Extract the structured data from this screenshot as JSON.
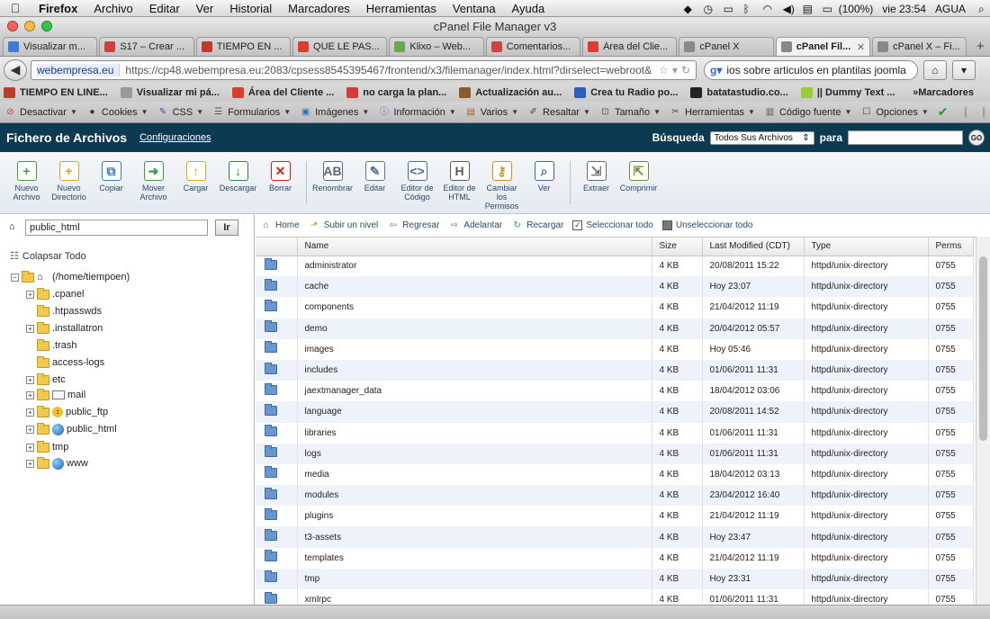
{
  "menubar": {
    "app": "Firefox",
    "items": [
      "Archivo",
      "Editar",
      "Ver",
      "Historial",
      "Marcadores",
      "Herramientas",
      "Ventana",
      "Ayuda"
    ],
    "battery": "(100%)",
    "clock": "vie 23:54",
    "user": "AGUA"
  },
  "window": {
    "title": "cPanel File Manager v3"
  },
  "tabs": [
    {
      "label": "Visualizar m...",
      "color": "#3a7bd5"
    },
    {
      "label": "S17 – Crear ...",
      "color": "#d04040"
    },
    {
      "label": "TIEMPO EN ...",
      "color": "#c0392b"
    },
    {
      "label": "QUE LE PAS...",
      "color": "#e03b2c"
    },
    {
      "label": "Klixo – Web...",
      "color": "#6aa84f"
    },
    {
      "label": "Comentarios...",
      "color": "#cc4444"
    },
    {
      "label": "Área del Clie...",
      "color": "#e03b2c"
    },
    {
      "label": "cPanel X",
      "color": "#888888"
    },
    {
      "label": "cPanel Fil...",
      "color": "#888888",
      "active": true
    },
    {
      "label": "cPanel X – Fi...",
      "color": "#888888"
    }
  ],
  "navbar": {
    "site": "webempresa.eu",
    "url": "https://cp48.webempresa.eu:2083/cpsess8545395467/frontend/x3/filemanager/index.html?dirselect=webroot&",
    "search": "ios sobre articulos en plantilas joomla"
  },
  "bookmarks": [
    {
      "label": "TIEMPO EN LINE...",
      "color": "#c0392b"
    },
    {
      "label": "Visualizar mi pá...",
      "color": "#999999"
    },
    {
      "label": "Área del Cliente ...",
      "color": "#e03b2c"
    },
    {
      "label": "no carga la plan...",
      "color": "#d43b3b"
    },
    {
      "label": "Actualización au...",
      "color": "#8b5a2b"
    },
    {
      "label": "Crea tu Radio po...",
      "color": "#2b5fbf"
    },
    {
      "label": "batatastudio.co...",
      "color": "#222222"
    },
    {
      "label": "|| Dummy Text ...",
      "color": "#9acd32"
    }
  ],
  "bookmarks_more": "Marcadores",
  "devbar": [
    "Desactivar",
    "Cookies",
    "CSS",
    "Formularios",
    "Imágenes",
    "Información",
    "Varios",
    "Resaltar",
    "Tamaño",
    "Herramientas",
    "Código fuente",
    "Opciones"
  ],
  "cpanel": {
    "title": "Fichero de Archivos",
    "config": "Configuraciones",
    "search_label": "Búsqueda",
    "search_scope": "Todos Sus Archivos",
    "search_para": "para",
    "go": "GO"
  },
  "toolbar": [
    {
      "label": "Nuevo Archivo",
      "color": "#4a9a3a",
      "glyph": "+"
    },
    {
      "label": "Nuevo Directorio",
      "color": "#e0a020",
      "glyph": "+"
    },
    {
      "label": "Copiar",
      "color": "#3a7ac0",
      "glyph": "⧉"
    },
    {
      "label": "Mover Archivo",
      "color": "#3a9a4a",
      "glyph": "➜"
    },
    {
      "label": "Cargar",
      "color": "#e0a020",
      "glyph": "↑"
    },
    {
      "label": "Descargar",
      "color": "#2a8a3a",
      "glyph": "↓"
    },
    {
      "label": "Borrar",
      "color": "#d02020",
      "glyph": "✕"
    },
    {
      "label": "Renombrar",
      "color": "#5a6a7a",
      "glyph": "AB"
    },
    {
      "label": "Editar",
      "color": "#5a7a9a",
      "glyph": "✎"
    },
    {
      "label": "Editor de Código",
      "color": "#4a6a9a",
      "glyph": "&lt;&gt;"
    },
    {
      "label": "Editor de HTML",
      "color": "#5a5a5a",
      "glyph": "H"
    },
    {
      "label": "Cambiar los Permisos",
      "color": "#d09020",
      "glyph": "⚷"
    },
    {
      "label": "Ver",
      "color": "#3a6aa0",
      "glyph": "⌕"
    },
    {
      "label": "Extraer",
      "color": "#6a6a6a",
      "glyph": "⇲"
    },
    {
      "label": "Comprimir",
      "color": "#6a8a3a",
      "glyph": "⇱"
    }
  ],
  "left": {
    "path": "public_html",
    "go": "Ir",
    "collapse": "Colapsar Todo",
    "root": "(/home/tiempoen)",
    "tree": [
      {
        "label": ".cpanel",
        "exp": true,
        "icon": "folder"
      },
      {
        "label": ".htpasswds",
        "exp": false,
        "icon": "folder"
      },
      {
        "label": ".installatron",
        "exp": true,
        "icon": "folder"
      },
      {
        "label": ".trash",
        "exp": false,
        "icon": "folder"
      },
      {
        "label": "access-logs",
        "exp": false,
        "icon": "folder"
      },
      {
        "label": "etc",
        "exp": true,
        "icon": "folder"
      },
      {
        "label": "mail",
        "exp": true,
        "icon": "mail"
      },
      {
        "label": "public_ftp",
        "exp": true,
        "icon": "ftp"
      },
      {
        "label": "public_html",
        "exp": true,
        "icon": "globe"
      },
      {
        "label": "tmp",
        "exp": true,
        "icon": "folder"
      },
      {
        "label": "www",
        "exp": true,
        "icon": "globe"
      }
    ]
  },
  "navrow": {
    "home": "Home",
    "up": "Subir un nivel",
    "back": "Regresar",
    "forward": "Adelantar",
    "reload": "Recargar",
    "selectall": "Seleccionar todo",
    "unselectall": "Unseleccionar todo"
  },
  "table": {
    "headers": [
      "Name",
      "Size",
      "Last Modified (CDT)",
      "Type",
      "Perms"
    ],
    "rows": [
      [
        "administrator",
        "4 KB",
        "20/08/2011 15:22",
        "httpd/unix-directory",
        "0755"
      ],
      [
        "cache",
        "4 KB",
        "Hoy 23:07",
        "httpd/unix-directory",
        "0755"
      ],
      [
        "components",
        "4 KB",
        "21/04/2012 11:19",
        "httpd/unix-directory",
        "0755"
      ],
      [
        "demo",
        "4 KB",
        "20/04/2012 05:57",
        "httpd/unix-directory",
        "0755"
      ],
      [
        "images",
        "4 KB",
        "Hoy 05:46",
        "httpd/unix-directory",
        "0755"
      ],
      [
        "includes",
        "4 KB",
        "01/06/2011 11:31",
        "httpd/unix-directory",
        "0755"
      ],
      [
        "jaextmanager_data",
        "4 KB",
        "18/04/2012 03:06",
        "httpd/unix-directory",
        "0755"
      ],
      [
        "language",
        "4 KB",
        "20/08/2011 14:52",
        "httpd/unix-directory",
        "0755"
      ],
      [
        "libraries",
        "4 KB",
        "01/06/2011 11:31",
        "httpd/unix-directory",
        "0755"
      ],
      [
        "logs",
        "4 KB",
        "01/06/2011 11:31",
        "httpd/unix-directory",
        "0755"
      ],
      [
        "media",
        "4 KB",
        "18/04/2012 03:13",
        "httpd/unix-directory",
        "0755"
      ],
      [
        "modules",
        "4 KB",
        "23/04/2012 16:40",
        "httpd/unix-directory",
        "0755"
      ],
      [
        "plugins",
        "4 KB",
        "21/04/2012 11:19",
        "httpd/unix-directory",
        "0755"
      ],
      [
        "t3-assets",
        "4 KB",
        "Hoy 23:47",
        "httpd/unix-directory",
        "0755"
      ],
      [
        "templates",
        "4 KB",
        "21/04/2012 11:19",
        "httpd/unix-directory",
        "0755"
      ],
      [
        "tmp",
        "4 KB",
        "Hoy 23:31",
        "httpd/unix-directory",
        "0755"
      ],
      [
        "xmlrpc",
        "4 KB",
        "01/06/2011 11:31",
        "httpd/unix-directory",
        "0755"
      ]
    ]
  }
}
